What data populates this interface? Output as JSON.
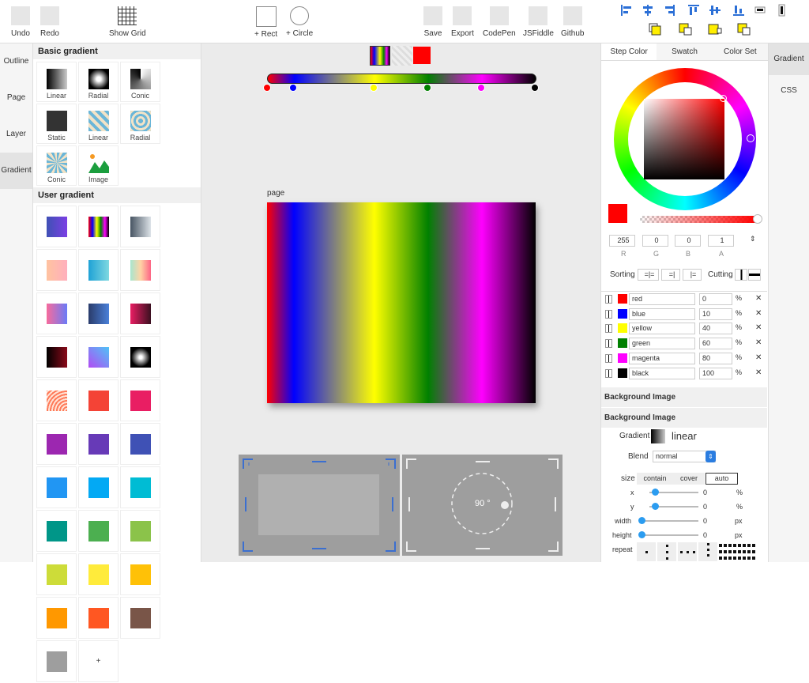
{
  "toolbar": {
    "undo": "Undo",
    "redo": "Redo",
    "show_grid": "Show Grid",
    "add_rect": "+ Rect",
    "add_circle": "+ Circle",
    "save": "Save",
    "export": "Export",
    "codepen": "CodePen",
    "jsfiddle": "JSFiddle",
    "github": "Github"
  },
  "left_nav": [
    "Outline",
    "Page",
    "Layer",
    "Gradient"
  ],
  "library": {
    "basic_title": "Basic gradient",
    "basic": [
      "Linear",
      "Radial",
      "Conic",
      "Static",
      "Linear",
      "Radial",
      "Conic",
      "Image"
    ],
    "user_title": "User gradient",
    "add_label": "+"
  },
  "canvas": {
    "page_label": "page",
    "angle_label": "90 °"
  },
  "stops": [
    {
      "name": "red",
      "pos": "0",
      "color": "#ff0000"
    },
    {
      "name": "blue",
      "pos": "10",
      "color": "#0000ff"
    },
    {
      "name": "yellow",
      "pos": "40",
      "color": "#ffff00"
    },
    {
      "name": "green",
      "pos": "60",
      "color": "#008000"
    },
    {
      "name": "magenta",
      "pos": "80",
      "color": "#ff00ff"
    },
    {
      "name": "black",
      "pos": "100",
      "color": "#000000"
    }
  ],
  "unit_pct": "%",
  "right": {
    "tabs": [
      "Step Color",
      "Swatch",
      "Color Set"
    ],
    "r": "255",
    "g": "0",
    "b": "0",
    "a": "1",
    "lbl_r": "R",
    "lbl_g": "G",
    "lbl_b": "B",
    "lbl_a": "A",
    "sorting": "Sorting",
    "sort_btns": [
      "=|=",
      "=|",
      "|="
    ],
    "cutting": "Cutting",
    "bg_image1": "Background Image",
    "bg_image2": "Background Image",
    "gradient_label": "Gradient",
    "gradient_type": "linear",
    "blend_label": "Blend",
    "blend_value": "normal",
    "size_label": "size",
    "size_opts": [
      "contain",
      "cover",
      "auto"
    ],
    "x_label": "x",
    "x_val": "0",
    "y_label": "y",
    "y_val": "0",
    "width_label": "width",
    "width_val": "0",
    "height_label": "height",
    "height_val": "0",
    "px": "px",
    "pct": "%",
    "repeat_label": "repeat"
  },
  "right_nav": [
    "Gradient",
    "CSS"
  ],
  "colors": {
    "accent": "#2b9cf0",
    "selected": "#ff0000"
  }
}
